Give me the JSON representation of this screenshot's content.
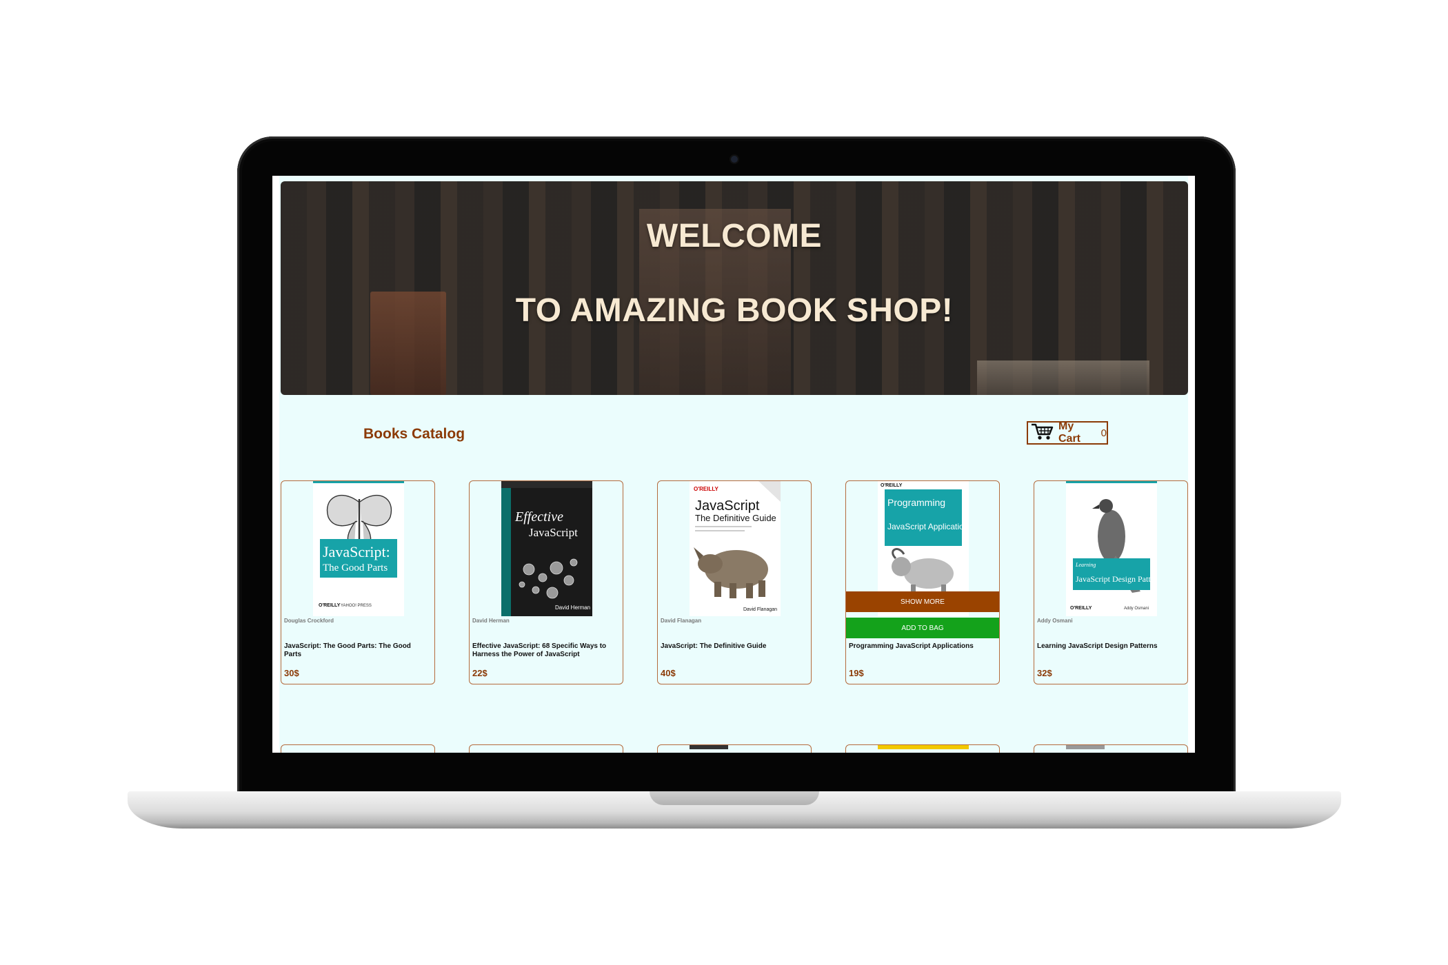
{
  "hero": {
    "line1": "WELCOME",
    "line2": "TO AMAZING BOOK SHOP!"
  },
  "catalog": {
    "title": "Books Catalog"
  },
  "cart": {
    "label": "My Cart",
    "count": "0",
    "icon": "shopping-cart-icon"
  },
  "colors": {
    "accent": "#8b3a06",
    "page_background": "#ebfdfd",
    "show_more_button": "#9a4300",
    "add_to_bag_button": "#14a21b"
  },
  "books": [
    {
      "author": "Douglas Crockford",
      "title": "JavaScript: The Good Parts: The Good Parts",
      "price": "30$",
      "cover": {
        "line1": "JavaScript:",
        "line2": "The Good Parts",
        "publisher": "O'REILLY",
        "extra": "YAHOO! PRESS",
        "bg": "#ffffff",
        "band": "#17a3a8"
      }
    },
    {
      "author": "David Herman",
      "title": "Effective JavaScript: 68 Specific Ways to Harness the Power of JavaScript",
      "price": "22$",
      "cover": {
        "line1": "Effective",
        "line2": "JavaScript",
        "publisher": "",
        "extra": "David Herman",
        "bg": "#1a1a1a",
        "band": "#0b6f6a"
      }
    },
    {
      "author": "David Flanagan",
      "title": "JavaScript: The Definitive Guide",
      "price": "40$",
      "cover": {
        "line1": "JavaScript",
        "line2": "The Definitive Guide",
        "publisher": "O'REILLY",
        "extra": "David Flanagan",
        "bg": "#ffffff",
        "band": "#ffffff"
      }
    },
    {
      "author": "",
      "title": "Programming JavaScript Applications",
      "price": "19$",
      "cover": {
        "line1": "Programming",
        "line2": "JavaScript Applications",
        "publisher": "O'REILLY",
        "extra": "",
        "bg": "#ffffff",
        "band": "#17a3a8"
      },
      "show_more": "SHOW MORE",
      "add_to_bag": "ADD TO BAG"
    },
    {
      "author": "Addy Osmani",
      "title": "Learning JavaScript Design Patterns",
      "price": "32$",
      "cover": {
        "line1": "Learning",
        "line2": "JavaScript Design Patterns",
        "publisher": "O'REILLY",
        "extra": "Addy Osmani",
        "bg": "#ffffff",
        "band": "#17a3a8"
      }
    }
  ]
}
